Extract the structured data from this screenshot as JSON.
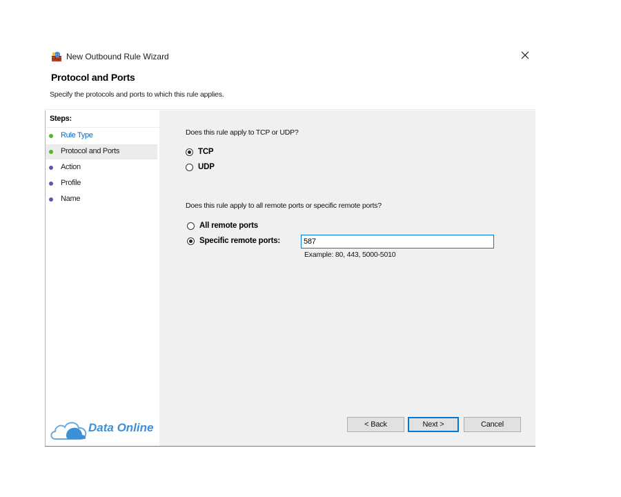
{
  "window": {
    "title": "New Outbound Rule Wizard",
    "close_icon": "close-icon"
  },
  "header": {
    "title": "Protocol and Ports",
    "description": "Specify the protocols and ports to which this rule applies."
  },
  "steps": {
    "heading": "Steps:",
    "items": [
      {
        "label": "Rule Type",
        "state": "completed",
        "dot_color": "#5cb030",
        "text_color": "#0066cc"
      },
      {
        "label": "Protocol and Ports",
        "state": "current",
        "dot_color": "#5cb030",
        "text_color": "#1a1a1a"
      },
      {
        "label": "Action",
        "state": "pending",
        "dot_color": "#5a5aad",
        "text_color": "#1a1a1a"
      },
      {
        "label": "Profile",
        "state": "pending",
        "dot_color": "#5a5aad",
        "text_color": "#1a1a1a"
      },
      {
        "label": "Name",
        "state": "pending",
        "dot_color": "#5a5aad",
        "text_color": "#1a1a1a"
      }
    ]
  },
  "protocol": {
    "question": "Does this rule apply to TCP or UDP?",
    "options": [
      {
        "label": "TCP",
        "checked": true
      },
      {
        "label": "UDP",
        "checked": false
      }
    ]
  },
  "ports": {
    "question": "Does this rule apply to all remote ports or specific remote ports?",
    "options": [
      {
        "label": "All remote ports",
        "checked": false
      },
      {
        "label": "Specific remote ports:",
        "checked": true
      }
    ],
    "input_value": "587",
    "example": "Example: 80, 443, 5000-5010"
  },
  "buttons": {
    "back": "< Back",
    "next": "Next >",
    "cancel": "Cancel"
  },
  "logo": {
    "text": "Data Online",
    "icon": "cloud-icon",
    "color": "#3d8fd6"
  },
  "colors": {
    "accent": "#0078d7",
    "content_bg": "#f0f0f0"
  }
}
